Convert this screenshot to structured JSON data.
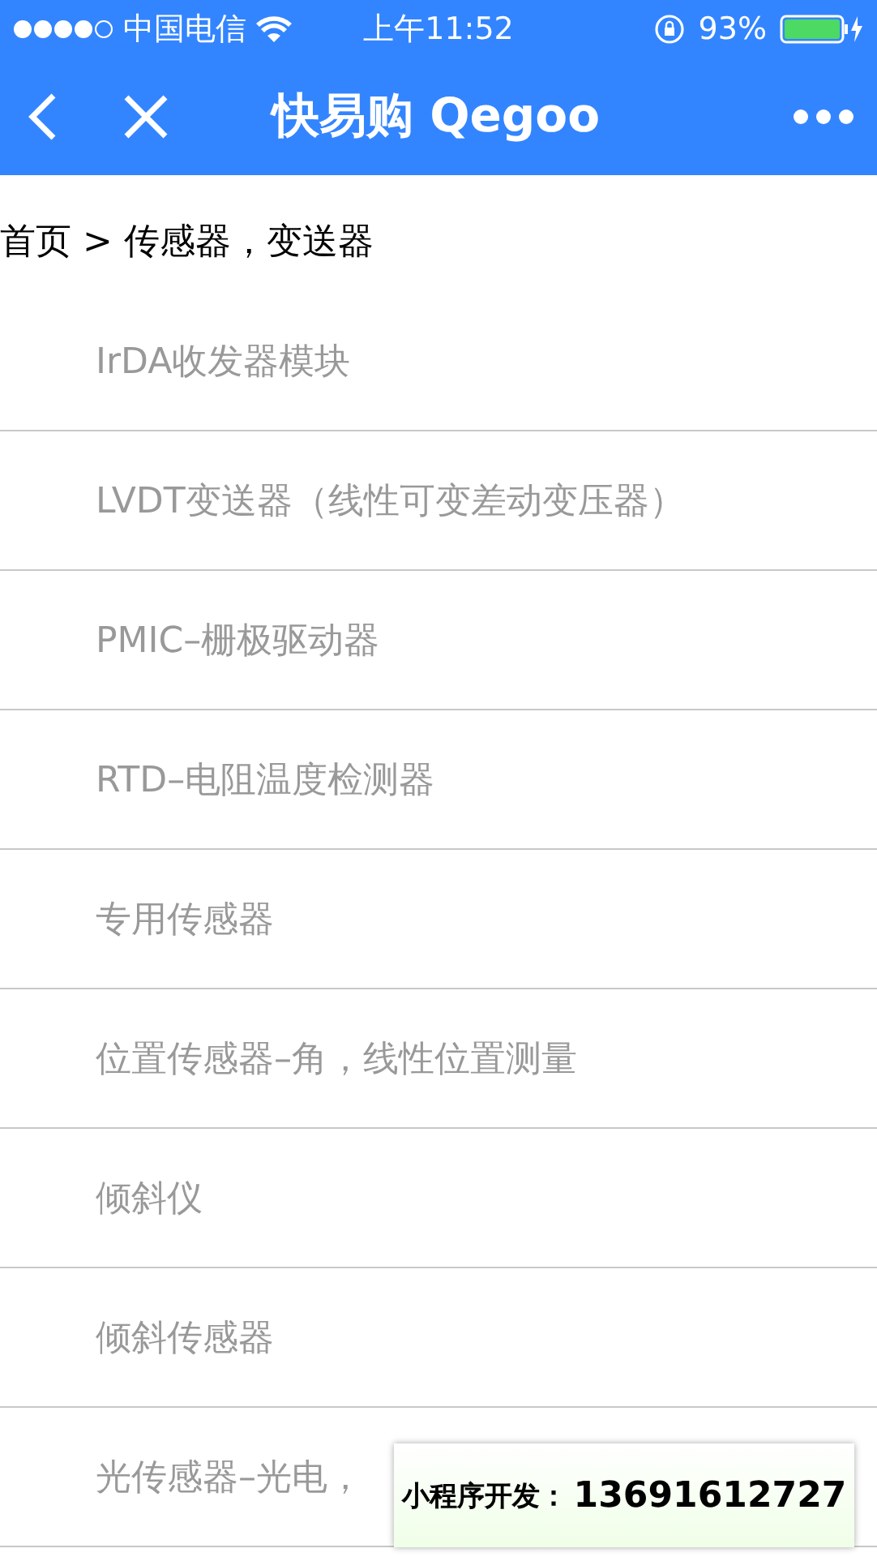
{
  "status_bar": {
    "carrier": "中国电信",
    "time": "上午11:52",
    "battery": "93%"
  },
  "nav": {
    "title": "快易购 Qegoo"
  },
  "breadcrumb": "首页 > 传感器，变送器",
  "items": [
    {
      "label": "IrDA收发器模块"
    },
    {
      "label": "LVDT变送器（线性可变差动变压器）"
    },
    {
      "label": "PMIC–栅极驱动器"
    },
    {
      "label": "RTD–电阻温度检测器"
    },
    {
      "label": "专用传感器"
    },
    {
      "label": "位置传感器–角，线性位置测量"
    },
    {
      "label": "倾斜仪"
    },
    {
      "label": "倾斜传感器"
    },
    {
      "label": "光传感器–光电，"
    }
  ],
  "badge": {
    "label": "小程序开发：",
    "phone": "13691612727"
  }
}
